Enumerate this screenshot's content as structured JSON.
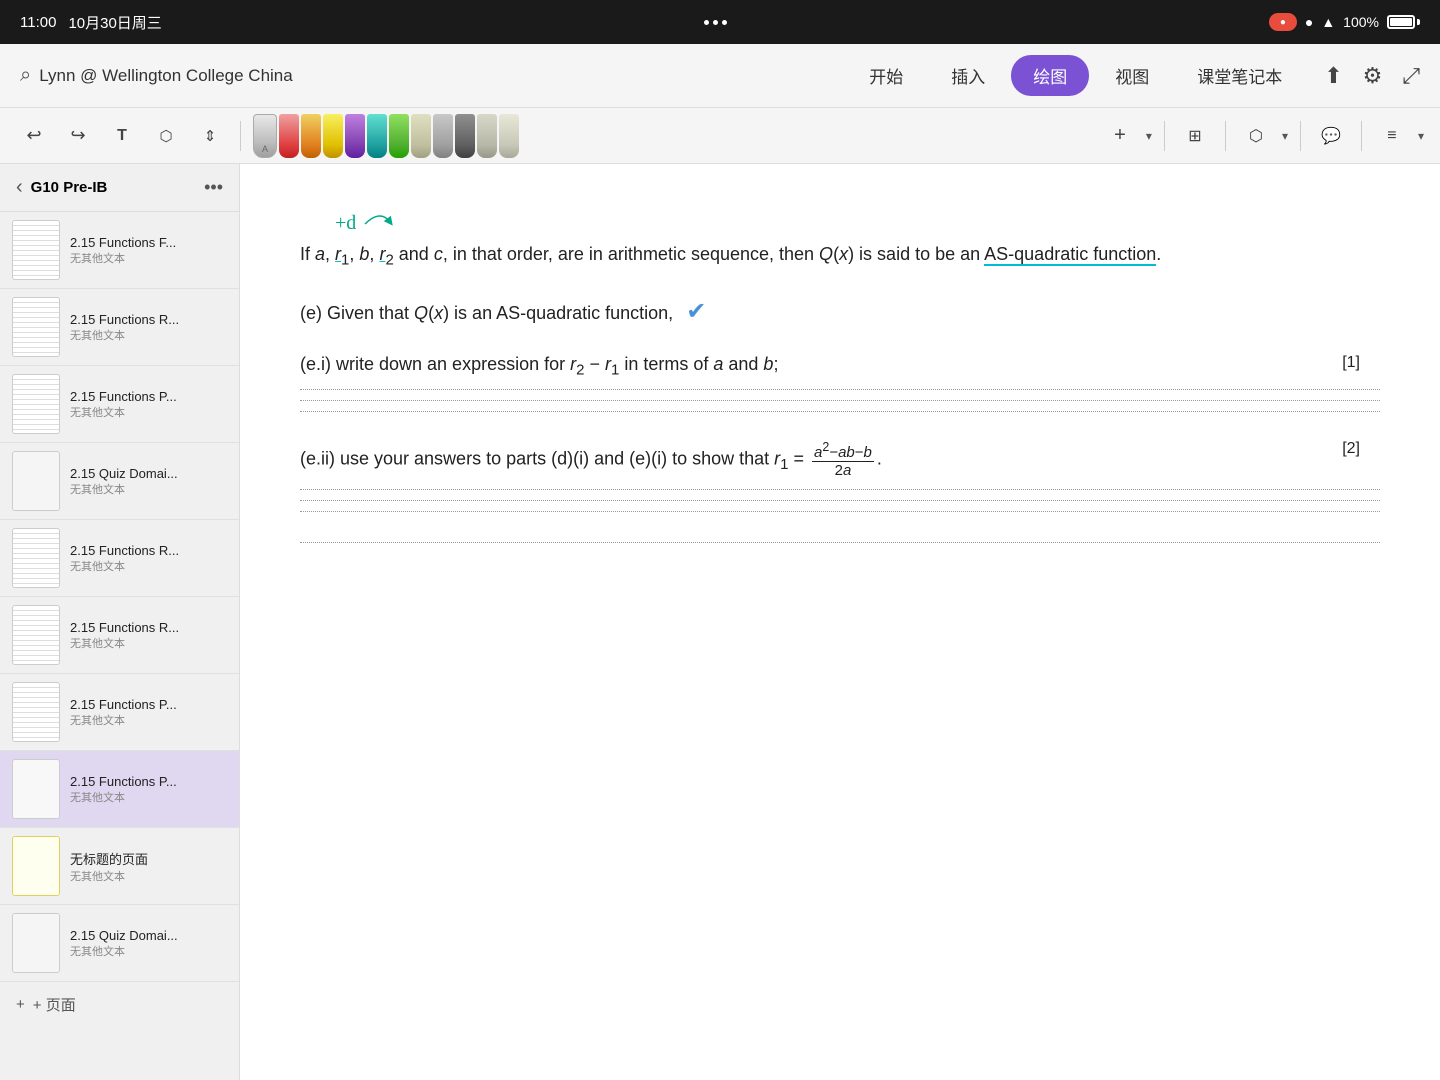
{
  "statusBar": {
    "time": "11:00",
    "date": "10月30日周三",
    "dots": 3,
    "battery": "100%"
  },
  "appBar": {
    "searchPlaceholder": "Lynn @ Wellington College China",
    "tabs": [
      "开始",
      "插入",
      "绘图",
      "视图",
      "课堂笔记本"
    ],
    "activeTab": "绘图"
  },
  "toolbar": {
    "undoLabel": "↩",
    "redoLabel": "↪",
    "textLabel": "T",
    "lassoLabel": "◯",
    "moveLabel": "⇕"
  },
  "sidebar": {
    "title": "G10 Pre-IB",
    "items": [
      {
        "title": "2.15 Functions F...",
        "sub": "无其他文本",
        "active": false
      },
      {
        "title": "2.15 Functions R...",
        "sub": "无其他文本",
        "active": false
      },
      {
        "title": "2.15 Functions P...",
        "sub": "无其他文本",
        "active": false
      },
      {
        "title": "2.15 Quiz Domai...",
        "sub": "无其他文本",
        "active": false
      },
      {
        "title": "2.15 Functions R...",
        "sub": "无其他文本",
        "active": false
      },
      {
        "title": "2.15 Functions R...",
        "sub": "无其他文本",
        "active": false
      },
      {
        "title": "2.15 Functions P...",
        "sub": "无其他文本",
        "active": false
      },
      {
        "title": "2.15 Functions P...",
        "sub": "无其他文本",
        "active": true
      },
      {
        "title": "无标题的页面",
        "sub": "无其他文本",
        "active": false
      },
      {
        "title": "2.15 Quiz Domai...",
        "sub": "无其他文本",
        "active": false
      }
    ],
    "addLabel": "+ 页面"
  },
  "content": {
    "annotation": "+d",
    "paragraph1": "If a, r₁, b, r₂ and c, in that order, are in arithmetic sequence, then Q(x) is said to be an AS-quadratic function.",
    "questionE": "(e) Given that Q(x) is an AS-quadratic function,",
    "questionEi": "(e.i) write down an expression for r₂ − r₁ in terms of a and b;",
    "markEi": "[1]",
    "questionEii": "(e.ii) use your answers to parts (d)(i) and (e)(i) to show that",
    "markEii": "[2]",
    "r1Formula": "r₁ = (a²−ab−b) / 2a"
  }
}
